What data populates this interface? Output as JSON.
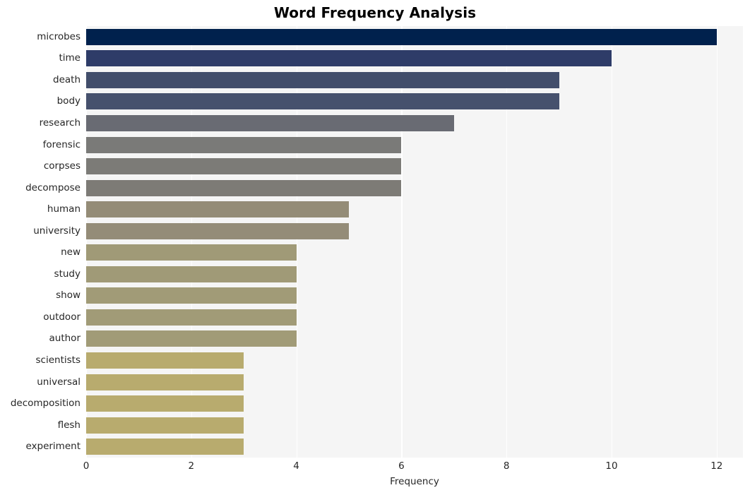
{
  "chart_data": {
    "type": "bar",
    "orientation": "horizontal",
    "title": "Word Frequency Analysis",
    "xlabel": "Frequency",
    "ylabel": "",
    "xlim": [
      0,
      12.5
    ],
    "xticks": [
      0,
      2,
      4,
      6,
      8,
      10,
      12
    ],
    "xtick_labels": [
      "0",
      "2",
      "4",
      "6",
      "8",
      "10",
      "12"
    ],
    "grid": true,
    "grid_color": "#ffffff",
    "plot_background": "#f5f5f5",
    "figure_background": "#ffffff",
    "legend": null,
    "categories": [
      "microbes",
      "time",
      "death",
      "body",
      "research",
      "forensic",
      "corpses",
      "decompose",
      "human",
      "university",
      "new",
      "study",
      "show",
      "outdoor",
      "author",
      "scientists",
      "universal",
      "decomposition",
      "flesh",
      "experiment"
    ],
    "values": [
      12,
      10,
      9,
      9,
      7,
      6,
      6,
      6,
      5,
      5,
      4,
      4,
      4,
      4,
      4,
      3,
      3,
      3,
      3,
      3
    ],
    "bar_colors": [
      "#00214d",
      "#2e3c68",
      "#424e6b",
      "#46516d",
      "#696b73",
      "#7a7a78",
      "#7c7b77",
      "#7d7b76",
      "#948c77",
      "#948c78",
      "#a09a77",
      "#a09a77",
      "#a19b77",
      "#a19b77",
      "#a19b77",
      "#b8ab6e",
      "#b8ab6e",
      "#b8ab6e",
      "#b8ab6e",
      "#b8ab6e"
    ]
  }
}
